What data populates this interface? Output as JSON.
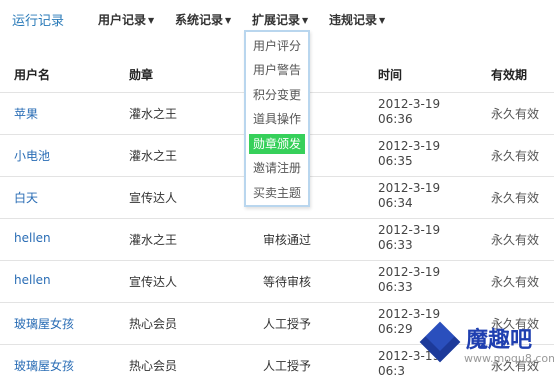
{
  "nav": {
    "brand": "运行记录",
    "menus": [
      {
        "label": "用户记录"
      },
      {
        "label": "系统记录"
      },
      {
        "label": "扩展记录"
      },
      {
        "label": "违规记录"
      }
    ],
    "arrow": "▼"
  },
  "dropdown": {
    "items": [
      "用户评分",
      "用户警告",
      "积分变更",
      "道具操作",
      "勋章颁发",
      "邀请注册",
      "买卖主题"
    ],
    "active_index": 4
  },
  "table": {
    "headers": [
      "用户名",
      "勋章",
      "",
      "时间",
      "有效期"
    ],
    "rows": [
      {
        "user": "苹果",
        "medal": "灌水之王",
        "op": "",
        "time1": "2012-3-19",
        "time2": "06:36",
        "valid": "永久有效"
      },
      {
        "user": "小电池",
        "medal": "灌水之王",
        "op": "",
        "time1": "2012-3-19",
        "time2": "06:35",
        "valid": "永久有效"
      },
      {
        "user": "白天",
        "medal": "宣传达人",
        "op": "",
        "time1": "2012-3-19",
        "time2": "06:34",
        "valid": "永久有效"
      },
      {
        "user": "hellen",
        "medal": "灌水之王",
        "op": "审核通过",
        "time1": "2012-3-19",
        "time2": "06:33",
        "valid": "永久有效"
      },
      {
        "user": "hellen",
        "medal": "宣传达人",
        "op": "等待审核",
        "time1": "2012-3-19",
        "time2": "06:33",
        "valid": "永久有效"
      },
      {
        "user": "玻璃屋女孩",
        "medal": "热心会员",
        "op": "人工授予",
        "time1": "2012-3-19",
        "time2": "06:29",
        "valid": "永久有效"
      },
      {
        "user": "玻璃屋女孩",
        "medal": "热心会员",
        "op": "人工授予",
        "time1": "2012-3-19",
        "time2": "06:3",
        "valid": "永久有效"
      }
    ]
  },
  "watermark": {
    "title": "魔趣吧",
    "url": "www.moqu8.com"
  },
  "colors": {
    "link": "#2a6db5",
    "brand": "#2a7ab8",
    "dropdown_border": "#b9d6ee",
    "active_item": "#36d05a"
  }
}
